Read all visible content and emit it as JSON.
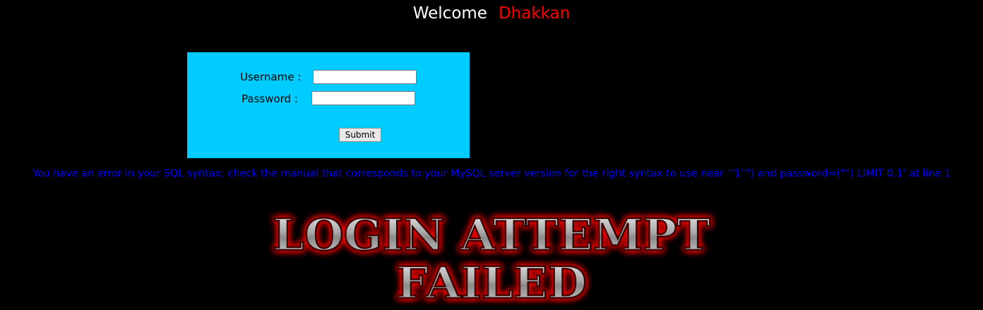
{
  "header": {
    "welcome": "Welcome",
    "name": "Dhakkan"
  },
  "login_form": {
    "username_label": "Username :",
    "password_label": "Password :",
    "username_value": "",
    "password_value": "",
    "submit_label": "Submit"
  },
  "error_message": "You have an error in your SQL syntax; check the manual that corresponds to your MySQL server version for the right syntax to use near '\"1\"\") and password=(\"\") LIMIT 0,1' at line 1",
  "banner": {
    "line1": "LOGIN ATTEMPT",
    "line2": "FAILED"
  },
  "colors": {
    "background": "#000000",
    "form_background": "#00ccff",
    "name_color": "#ff0000",
    "error_color": "#0000ff",
    "banner_glow": "#ff0000"
  }
}
